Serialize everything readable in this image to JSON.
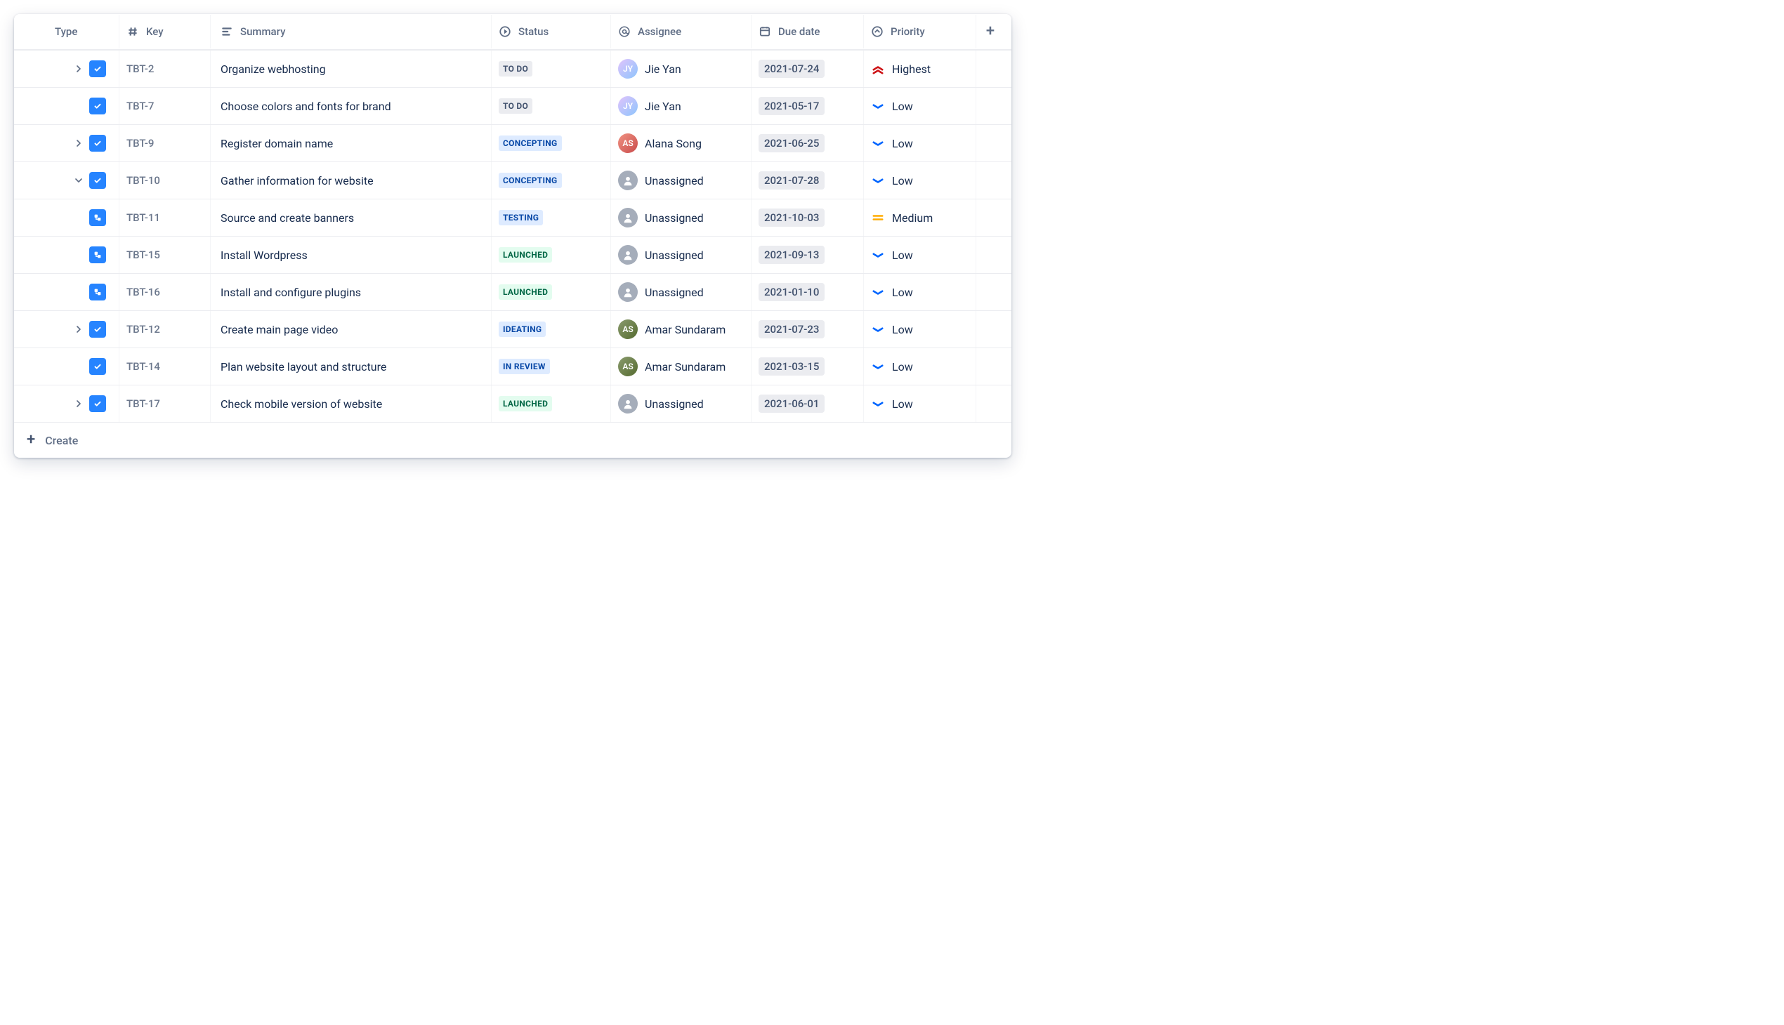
{
  "columns": {
    "type": "Type",
    "key": "Key",
    "summary": "Summary",
    "status": "Status",
    "assignee": "Assignee",
    "due": "Due date",
    "priority": "Priority"
  },
  "create_label": "Create",
  "rows": [
    {
      "chevron": "right",
      "indent": 0,
      "iconType": "task",
      "key": "TBT-2",
      "summary": "Organize webhosting",
      "status": "TO DO",
      "statusCategory": "todo",
      "assignee": "Jie Yan",
      "avatar": "jie",
      "due": "2021-07-24",
      "priority": "Highest",
      "priorityLevel": "highest"
    },
    {
      "chevron": "",
      "indent": 0,
      "iconType": "task",
      "key": "TBT-7",
      "summary": "Choose colors and fonts for brand",
      "status": "TO DO",
      "statusCategory": "todo",
      "assignee": "Jie Yan",
      "avatar": "jie",
      "due": "2021-05-17",
      "priority": "Low",
      "priorityLevel": "low"
    },
    {
      "chevron": "right",
      "indent": 0,
      "iconType": "task",
      "key": "TBT-9",
      "summary": "Register domain name",
      "status": "CONCEPTING",
      "statusCategory": "inprogress",
      "assignee": "Alana Song",
      "avatar": "alana",
      "due": "2021-06-25",
      "priority": "Low",
      "priorityLevel": "low"
    },
    {
      "chevron": "down",
      "indent": 0,
      "iconType": "task",
      "key": "TBT-10",
      "summary": "Gather information for website",
      "status": "CONCEPTING",
      "statusCategory": "inprogress",
      "assignee": "Unassigned",
      "avatar": "unassigned",
      "due": "2021-07-28",
      "priority": "Low",
      "priorityLevel": "low"
    },
    {
      "chevron": "",
      "indent": 1,
      "iconType": "subtask",
      "key": "TBT-11",
      "summary": "Source and create banners",
      "status": "TESTING",
      "statusCategory": "inprogress",
      "assignee": "Unassigned",
      "avatar": "unassigned",
      "due": "2021-10-03",
      "priority": "Medium",
      "priorityLevel": "medium"
    },
    {
      "chevron": "",
      "indent": 1,
      "iconType": "subtask",
      "key": "TBT-15",
      "summary": "Install Wordpress",
      "status": "LAUNCHED",
      "statusCategory": "done",
      "assignee": "Unassigned",
      "avatar": "unassigned",
      "due": "2021-09-13",
      "priority": "Low",
      "priorityLevel": "low"
    },
    {
      "chevron": "",
      "indent": 1,
      "iconType": "subtask",
      "key": "TBT-16",
      "summary": "Install and configure plugins",
      "status": "LAUNCHED",
      "statusCategory": "done",
      "assignee": "Unassigned",
      "avatar": "unassigned",
      "due": "2021-01-10",
      "priority": "Low",
      "priorityLevel": "low"
    },
    {
      "chevron": "right",
      "indent": 0,
      "iconType": "task",
      "key": "TBT-12",
      "summary": "Create main page video",
      "status": "IDEATING",
      "statusCategory": "inprogress",
      "assignee": "Amar Sundaram",
      "avatar": "amar",
      "due": "2021-07-23",
      "priority": "Low",
      "priorityLevel": "low"
    },
    {
      "chevron": "",
      "indent": 0,
      "iconType": "task",
      "key": "TBT-14",
      "summary": "Plan website layout and structure",
      "status": "IN REVIEW",
      "statusCategory": "inprogress",
      "assignee": "Amar Sundaram",
      "avatar": "amar",
      "due": "2021-03-15",
      "priority": "Low",
      "priorityLevel": "low"
    },
    {
      "chevron": "right",
      "indent": 0,
      "iconType": "task",
      "key": "TBT-17",
      "summary": "Check mobile version of website",
      "status": "LAUNCHED",
      "statusCategory": "done",
      "assignee": "Unassigned",
      "avatar": "unassigned",
      "due": "2021-06-01",
      "priority": "Low",
      "priorityLevel": "low"
    }
  ]
}
